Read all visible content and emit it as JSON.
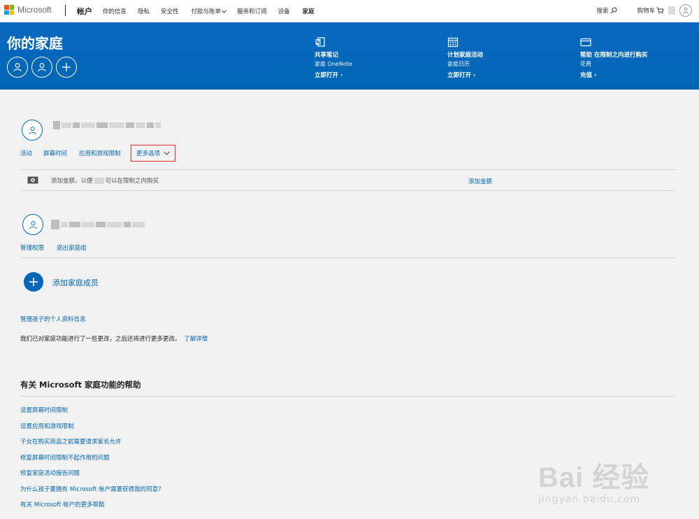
{
  "nav": {
    "logo_text": "Microsoft",
    "brand": "帐户",
    "links": [
      "你的信息",
      "隐私",
      "安全性",
      "付款与账单",
      "服务和订阅",
      "设备",
      "家庭"
    ],
    "search": "搜索",
    "cart": "购物车"
  },
  "banner": {
    "title": "你的家庭",
    "features": [
      {
        "icon": "onenote-icon",
        "title": "共享笔记",
        "sub": "家庭 OneNote",
        "link": "立即打开 ›"
      },
      {
        "icon": "calendar-icon",
        "title": "计划家庭活动",
        "sub": "家庭日历",
        "link": "立即打开 ›"
      },
      {
        "icon": "card-icon",
        "title": "帮助 在限制之内进行购买",
        "sub": "花费",
        "link": "充值 ›"
      }
    ]
  },
  "member1": {
    "tabs": [
      "活动",
      "屏幕时间",
      "应用和游戏限制"
    ],
    "more_options": "更多选项",
    "money_text_pre": "添加金额，以便",
    "money_text_post": "可以在限制之内购买",
    "add_money_link": "添加金额"
  },
  "member2": {
    "links": [
      "管理权限",
      "退出家庭组"
    ]
  },
  "add_member": "添加家庭成员",
  "manage_child_link": "管理孩子的个人资料信息",
  "notice_text": "我们已对家庭功能进行了一些更改，之后还将进行更多更改。",
  "notice_link": "了解详情",
  "help": {
    "title": "有关 Microsoft 家庭功能的帮助",
    "links": [
      "设置屏幕时间限制",
      "设置应用和游戏限制",
      "子女在购买商品之前需要请求家长允许",
      "修复屏幕时间限制不起作用的问题",
      "修复家庭活动报告问题",
      "为什么孩子要拥有 Microsoft 帐户需要获得我的同意?",
      "有关 Microsoft 帐户的更多帮助"
    ]
  },
  "watermark": {
    "main": "Bai 经验",
    "sub": "jingyan.baidu.com"
  },
  "colors": {
    "accent": "#0067b8",
    "banner": "#0066b4",
    "highlight": "#e02c2c"
  }
}
